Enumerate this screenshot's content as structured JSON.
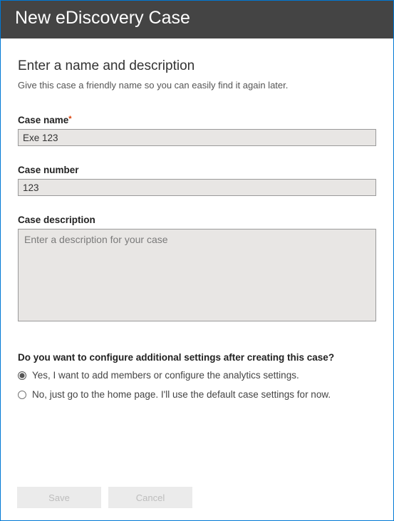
{
  "header": {
    "title": "New eDiscovery Case"
  },
  "section": {
    "title": "Enter a name and description",
    "description": "Give this case a friendly name so you can easily find it again later."
  },
  "fields": {
    "caseName": {
      "label": "Case name",
      "value": "Exe 123",
      "required": true
    },
    "caseNumber": {
      "label": "Case number",
      "value": "123"
    },
    "caseDescription": {
      "label": "Case description",
      "placeholder": "Enter a description for your case",
      "value": ""
    }
  },
  "question": {
    "label": "Do you want to configure additional settings after creating this case?",
    "options": {
      "yes": "Yes, I want to add members or configure the analytics settings.",
      "no": "No, just go to the home page. I'll use the default case settings for now."
    },
    "selected": "yes"
  },
  "buttons": {
    "save": "Save",
    "cancel": "Cancel"
  }
}
